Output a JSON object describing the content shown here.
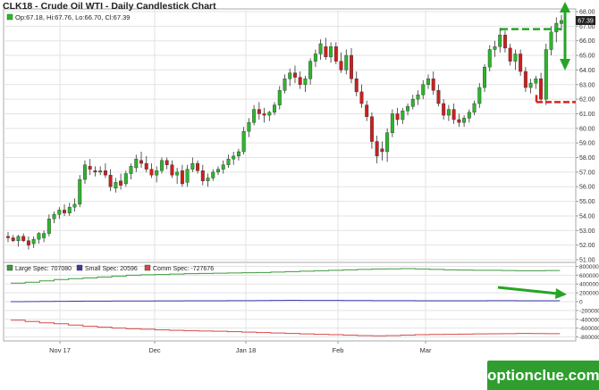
{
  "title": "CLK18 - Crude Oil WTI - Daily Candlestick Chart",
  "watermark": "optionclue.com",
  "colors": {
    "up": "#2db52d",
    "down": "#cc1f1f",
    "grid": "#e3e3e3",
    "axis": "#999999",
    "large_spec": "#3c9a3c",
    "small_spec": "#3a3aa8",
    "comm_spec": "#d44a4a",
    "annotation_green": "#25a525",
    "annotation_red": "#dd2222",
    "price_marker": "#222222"
  },
  "chart_data": [
    {
      "type": "candlestick",
      "ohlc_label": "Op:67.18, Hi:67.76, Lo:66.70, Cl:67.39",
      "last_price_label": "67.39",
      "last_price": 67.39,
      "ylim": [
        51,
        68
      ],
      "y_ticks": [
        "51.00",
        "52.00",
        "53.00",
        "54.00",
        "55.00",
        "56.00",
        "57.00",
        "58.00",
        "59.00",
        "60.00",
        "61.00",
        "62.00",
        "63.00",
        "64.00",
        "65.00",
        "66.00",
        "67.00",
        "68.00"
      ],
      "x_ticks": [
        "Nov 17",
        "Dec",
        "Jan 18",
        "Feb",
        "Mar"
      ],
      "candles": [
        [
          52.6,
          52.9,
          52.2,
          52.5
        ],
        [
          52.5,
          52.7,
          52.2,
          52.3
        ],
        [
          52.3,
          52.7,
          51.9,
          52.6
        ],
        [
          52.6,
          52.8,
          52.2,
          52.3
        ],
        [
          52.3,
          52.6,
          51.7,
          52.0
        ],
        [
          52.1,
          52.6,
          51.8,
          52.4
        ],
        [
          52.4,
          52.9,
          52.1,
          52.8
        ],
        [
          52.5,
          53.0,
          52.2,
          52.8
        ],
        [
          52.8,
          54.1,
          52.6,
          53.8
        ],
        [
          53.8,
          54.3,
          53.5,
          54.1
        ],
        [
          54.1,
          54.6,
          53.8,
          54.4
        ],
        [
          54.4,
          54.8,
          54.0,
          54.2
        ],
        [
          54.2,
          54.9,
          54.0,
          54.6
        ],
        [
          54.6,
          55.2,
          54.3,
          54.8
        ],
        [
          54.8,
          56.8,
          54.6,
          56.5
        ],
        [
          56.5,
          57.8,
          56.2,
          57.5
        ],
        [
          57.4,
          57.9,
          56.8,
          57.2
        ],
        [
          57.1,
          57.4,
          56.7,
          57.0
        ],
        [
          57.0,
          57.4,
          56.8,
          57.1
        ],
        [
          57.1,
          57.6,
          56.6,
          56.8
        ],
        [
          56.8,
          57.2,
          55.7,
          56.0
        ],
        [
          55.9,
          56.6,
          55.6,
          56.3
        ],
        [
          56.4,
          56.9,
          55.8,
          56.1
        ],
        [
          56.2,
          57.1,
          56.0,
          56.9
        ],
        [
          56.9,
          57.6,
          56.5,
          57.4
        ],
        [
          57.3,
          58.2,
          57.0,
          57.9
        ],
        [
          57.8,
          58.4,
          57.3,
          57.6
        ],
        [
          57.6,
          58.1,
          57.0,
          57.2
        ],
        [
          57.2,
          57.6,
          56.6,
          56.8
        ],
        [
          56.8,
          57.4,
          56.3,
          57.1
        ],
        [
          57.1,
          58.0,
          56.9,
          57.8
        ],
        [
          57.8,
          58.0,
          57.2,
          57.5
        ],
        [
          57.5,
          57.8,
          56.6,
          56.8
        ],
        [
          56.8,
          57.3,
          56.2,
          57.0
        ],
        [
          57.1,
          57.5,
          56.0,
          56.2
        ],
        [
          56.3,
          57.5,
          56.0,
          57.2
        ],
        [
          57.2,
          58.0,
          57.0,
          57.6
        ],
        [
          57.6,
          57.8,
          56.9,
          57.1
        ],
        [
          57.1,
          57.5,
          56.1,
          56.4
        ],
        [
          56.4,
          56.9,
          56.0,
          56.6
        ],
        [
          56.6,
          57.2,
          56.4,
          57.0
        ],
        [
          57.0,
          57.4,
          56.8,
          57.2
        ],
        [
          57.2,
          57.8,
          56.9,
          57.5
        ],
        [
          57.5,
          58.2,
          57.3,
          57.9
        ],
        [
          57.9,
          58.4,
          57.5,
          58.1
        ],
        [
          58.1,
          58.6,
          57.8,
          58.4
        ],
        [
          58.4,
          60.1,
          58.2,
          59.8
        ],
        [
          59.8,
          60.7,
          59.4,
          60.4
        ],
        [
          60.4,
          61.6,
          60.2,
          61.3
        ],
        [
          61.3,
          61.8,
          60.6,
          61.0
        ],
        [
          61.0,
          61.4,
          60.4,
          60.9
        ],
        [
          60.9,
          61.2,
          60.5,
          61.1
        ],
        [
          61.1,
          61.8,
          60.9,
          61.6
        ],
        [
          61.6,
          62.9,
          61.3,
          62.6
        ],
        [
          62.6,
          63.7,
          62.4,
          63.4
        ],
        [
          63.4,
          64.1,
          62.9,
          63.8
        ],
        [
          63.8,
          64.3,
          63.1,
          63.5
        ],
        [
          63.5,
          63.9,
          62.7,
          63.0
        ],
        [
          63.0,
          63.6,
          62.5,
          63.4
        ],
        [
          63.4,
          64.8,
          63.0,
          64.6
        ],
        [
          64.6,
          65.4,
          64.2,
          65.1
        ],
        [
          65.1,
          66.1,
          64.7,
          65.8
        ],
        [
          65.6,
          66.2,
          64.7,
          64.9
        ],
        [
          64.9,
          65.9,
          64.5,
          65.6
        ],
        [
          65.6,
          65.9,
          64.4,
          64.6
        ],
        [
          64.6,
          65.2,
          63.8,
          64.0
        ],
        [
          64.0,
          65.4,
          63.7,
          65.0
        ],
        [
          65.0,
          65.5,
          63.1,
          63.4
        ],
        [
          63.4,
          63.9,
          62.2,
          62.5
        ],
        [
          62.5,
          63.0,
          61.4,
          61.7
        ],
        [
          61.6,
          61.9,
          60.5,
          60.8
        ],
        [
          60.8,
          61.1,
          58.6,
          59.1
        ],
        [
          59.1,
          59.5,
          57.6,
          58.1
        ],
        [
          58.6,
          59.1,
          57.8,
          58.4
        ],
        [
          58.4,
          60.0,
          57.7,
          59.7
        ],
        [
          59.7,
          61.3,
          59.4,
          61.0
        ],
        [
          61.0,
          61.4,
          60.2,
          60.6
        ],
        [
          60.6,
          61.4,
          60.3,
          61.2
        ],
        [
          61.2,
          61.7,
          60.9,
          61.5
        ],
        [
          61.5,
          62.3,
          61.3,
          62.0
        ],
        [
          62.0,
          62.6,
          61.6,
          62.3
        ],
        [
          62.3,
          63.3,
          62.0,
          63.0
        ],
        [
          63.0,
          63.7,
          62.7,
          63.4
        ],
        [
          63.4,
          63.9,
          62.3,
          62.6
        ],
        [
          62.6,
          63.0,
          61.5,
          61.7
        ],
        [
          61.7,
          62.0,
          60.6,
          60.9
        ],
        [
          60.9,
          61.6,
          60.5,
          61.3
        ],
        [
          61.3,
          61.7,
          60.3,
          60.6
        ],
        [
          60.6,
          61.0,
          60.1,
          60.4
        ],
        [
          60.4,
          60.9,
          60.1,
          60.7
        ],
        [
          60.7,
          61.3,
          60.4,
          61.1
        ],
        [
          61.1,
          61.9,
          60.9,
          61.7
        ],
        [
          61.7,
          63.1,
          61.4,
          62.8
        ],
        [
          62.8,
          64.4,
          62.5,
          64.2
        ],
        [
          64.2,
          65.7,
          63.9,
          65.4
        ],
        [
          65.4,
          66.0,
          64.9,
          65.6
        ],
        [
          65.6,
          66.9,
          65.2,
          66.4
        ],
        [
          66.4,
          66.7,
          65.2,
          65.5
        ],
        [
          65.5,
          65.8,
          64.3,
          64.6
        ],
        [
          64.6,
          65.4,
          64.0,
          65.1
        ],
        [
          65.1,
          65.4,
          63.6,
          63.9
        ],
        [
          63.9,
          64.2,
          62.5,
          62.8
        ],
        [
          62.8,
          63.4,
          62.4,
          63.1
        ],
        [
          63.1,
          63.6,
          62.7,
          63.4
        ],
        [
          63.4,
          63.8,
          61.8,
          62.0
        ],
        [
          62.0,
          65.8,
          61.6,
          65.4
        ],
        [
          65.4,
          67.0,
          65.0,
          66.6
        ],
        [
          66.6,
          67.6,
          65.9,
          67.2
        ],
        [
          67.18,
          67.76,
          66.7,
          67.39
        ]
      ]
    },
    {
      "type": "line",
      "title": "COT positions",
      "ylim": [
        -850000,
        850000
      ],
      "y_ticks": [
        "800000",
        "600000",
        "400000",
        "200000",
        "0",
        "-200000",
        "-400000",
        "-600000",
        "-800000"
      ],
      "series": [
        {
          "name": "Large Spec: 707080",
          "key": "large_spec",
          "values": [
            420000,
            440000,
            470000,
            500000,
            520000,
            540000,
            560000,
            580000,
            600000,
            610000,
            615000,
            625000,
            635000,
            640000,
            645000,
            650000,
            655000,
            660000,
            670000,
            680000,
            690000,
            700000,
            710000,
            720000,
            730000,
            740000,
            745000,
            748000,
            740000,
            730000,
            720000,
            715000,
            712000,
            710000,
            705000,
            700000,
            700000,
            705000,
            707080
          ]
        },
        {
          "name": "Small Spec: 20596",
          "key": "small_spec",
          "values": [
            0,
            2000,
            5000,
            8000,
            10000,
            12000,
            13000,
            14000,
            15000,
            16000,
            17000,
            18000,
            19000,
            20000,
            21000,
            22000,
            24000,
            26000,
            28000,
            30000,
            29000,
            28000,
            27000,
            26000,
            25000,
            24000,
            23000,
            22000,
            21000,
            20000,
            20000,
            20000,
            21000,
            22000,
            22000,
            21000,
            21000,
            21000,
            20596
          ]
        },
        {
          "name": "Comm Spec: -727676",
          "key": "comm_spec",
          "values": [
            -420000,
            -450000,
            -480000,
            -500000,
            -530000,
            -560000,
            -580000,
            -600000,
            -615000,
            -625000,
            -640000,
            -650000,
            -660000,
            -665000,
            -670000,
            -680000,
            -690000,
            -700000,
            -710000,
            -720000,
            -730000,
            -740000,
            -750000,
            -760000,
            -770000,
            -775000,
            -770000,
            -760000,
            -750000,
            -745000,
            -740000,
            -735000,
            -730000,
            -728000,
            -725000,
            -722000,
            -724000,
            -726000,
            -727676
          ]
        }
      ],
      "annotations": [
        {
          "type": "dashed-line",
          "color": "green",
          "price": 66.8
        },
        {
          "type": "dashed-line",
          "color": "red",
          "price": 61.8
        },
        {
          "type": "arrow",
          "direction": "up-down",
          "color": "green"
        },
        {
          "type": "arrow",
          "direction": "down-right",
          "color": "green",
          "panel": "cot"
        }
      ]
    }
  ]
}
